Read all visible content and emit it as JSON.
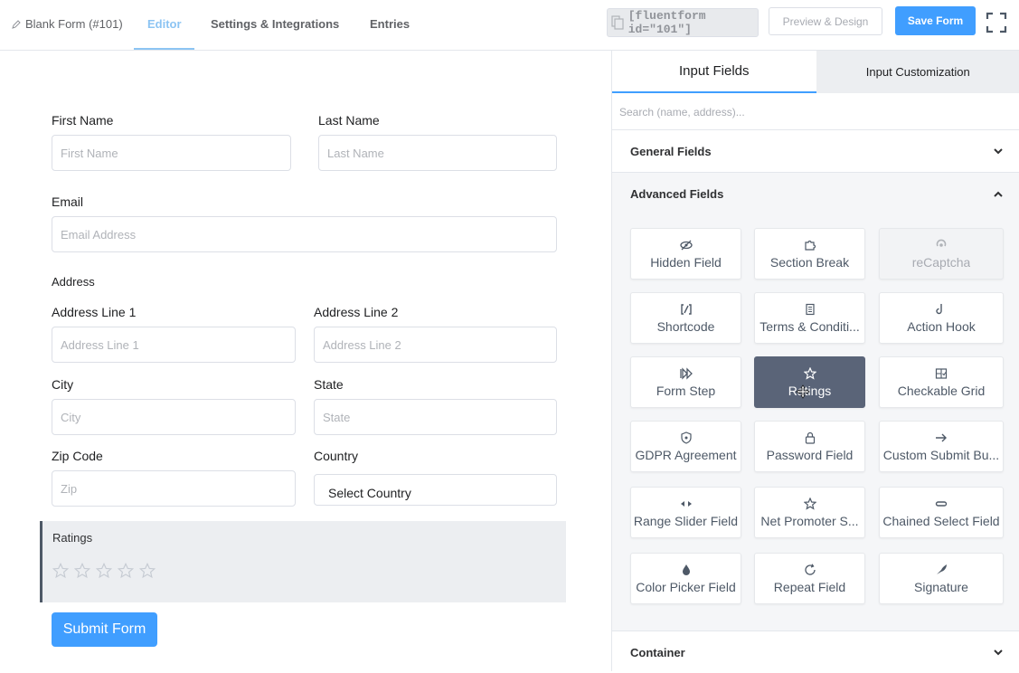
{
  "header": {
    "form_title": "Blank Form (#101)",
    "tabs": [
      {
        "label": "Editor"
      },
      {
        "label": "Settings & Integrations"
      },
      {
        "label": "Entries"
      }
    ],
    "shortcode": "[fluentform id=\"101\"]",
    "preview_label": "Preview & Design",
    "save_label": "Save Form"
  },
  "form": {
    "first_name": {
      "label": "First Name",
      "placeholder": "First Name"
    },
    "last_name": {
      "label": "Last Name",
      "placeholder": "Last Name"
    },
    "email": {
      "label": "Email",
      "placeholder": "Email Address"
    },
    "address_heading": "Address",
    "address_line1": {
      "label": "Address Line 1",
      "placeholder": "Address Line 1"
    },
    "address_line2": {
      "label": "Address Line 2",
      "placeholder": "Address Line 2"
    },
    "city": {
      "label": "City",
      "placeholder": "City"
    },
    "state": {
      "label": "State",
      "placeholder": "State"
    },
    "zip": {
      "label": "Zip Code",
      "placeholder": "Zip"
    },
    "country": {
      "label": "Country",
      "value": "Select Country"
    },
    "ratings": {
      "label": "Ratings",
      "stars": 5,
      "value": 0
    },
    "submit_label": "Submit Form"
  },
  "panel": {
    "tabs": [
      {
        "label": "Input Fields"
      },
      {
        "label": "Input Customization"
      }
    ],
    "search_placeholder": "Search (name, address)...",
    "sections": [
      {
        "label": "General Fields",
        "expanded": false
      },
      {
        "label": "Advanced Fields",
        "expanded": true
      },
      {
        "label": "Container",
        "expanded": false
      }
    ],
    "advanced_fields": [
      {
        "label": "Hidden Field",
        "icon": "eye-slash-icon"
      },
      {
        "label": "Section Break",
        "icon": "puzzle-icon"
      },
      {
        "label": "reCaptcha",
        "icon": "recaptcha-icon",
        "disabled": true
      },
      {
        "label": "Shortcode",
        "icon": "shortcode-icon"
      },
      {
        "label": "Terms & Conditi...",
        "icon": "scroll-icon"
      },
      {
        "label": "Action Hook",
        "icon": "hook-icon"
      },
      {
        "label": "Form Step",
        "icon": "step-icon"
      },
      {
        "label": "Ratings",
        "icon": "star-icon",
        "selected": true
      },
      {
        "label": "Checkable Grid",
        "icon": "grid-check-icon"
      },
      {
        "label": "GDPR Agreement",
        "icon": "shield-icon"
      },
      {
        "label": "Password Field",
        "icon": "lock-icon"
      },
      {
        "label": "Custom Submit Bu...",
        "icon": "arrow-right-icon"
      },
      {
        "label": "Range Slider Field",
        "icon": "range-icon"
      },
      {
        "label": "Net Promoter S...",
        "icon": "star-icon"
      },
      {
        "label": "Chained Select Field",
        "icon": "link-icon"
      },
      {
        "label": "Color Picker Field",
        "icon": "droplet-icon"
      },
      {
        "label": "Repeat Field",
        "icon": "repeat-icon"
      },
      {
        "label": "Signature",
        "icon": "feather-icon"
      }
    ]
  }
}
